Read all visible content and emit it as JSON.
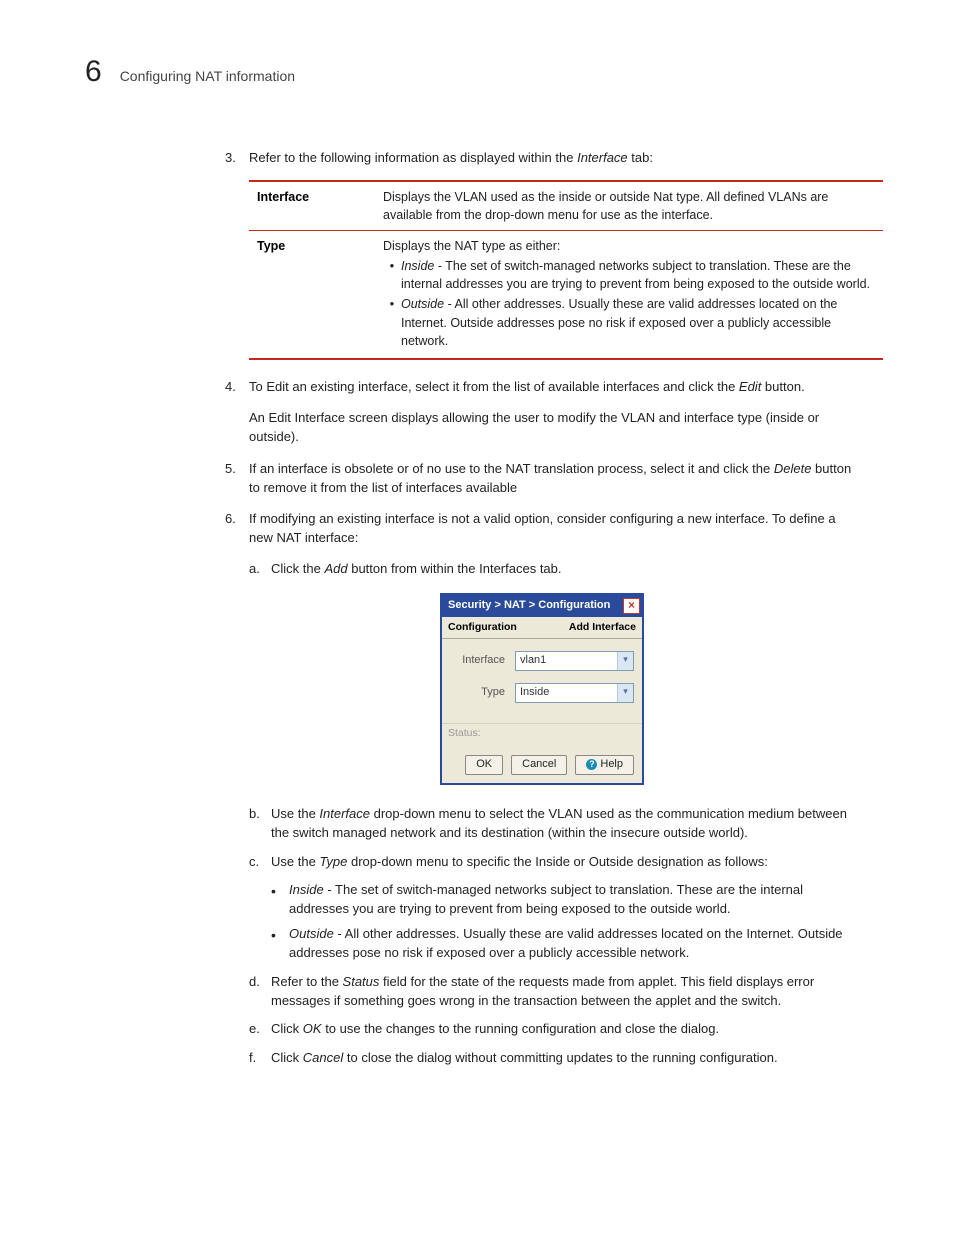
{
  "chapter_number": "6",
  "chapter_title": "Configuring NAT information",
  "step3": {
    "num": "3.",
    "pre": "Refer to the following information as displayed within the ",
    "em": "Interface",
    "post": " tab:"
  },
  "table": {
    "interface_label": "Interface",
    "interface_desc": "Displays the VLAN used as the inside or outside Nat type. All defined VLANs are available from the drop-down menu for use as the interface.",
    "type_label": "Type",
    "type_intro": "Displays the NAT type as either:",
    "type_inside_em": "Inside",
    "type_inside_txt": " - The set of switch-managed networks subject to translation. These are the internal addresses you are trying to prevent from being exposed to the outside world.",
    "type_outside_em": "Outside",
    "type_outside_txt": " - All other addresses. Usually these are valid addresses located on the Internet. Outside addresses pose no risk if exposed over a publicly accessible network."
  },
  "step4": {
    "num": "4.",
    "p1_a": "To Edit an existing interface, select it from the list of available interfaces and click the ",
    "p1_em": "Edit",
    "p1_b": " button.",
    "p2": "An Edit Interface screen displays allowing the user to modify the VLAN and interface type (inside or outside)."
  },
  "step5": {
    "num": "5.",
    "a": "If an interface is obsolete or of no use to the NAT translation process, select it and click the ",
    "em": "Delete",
    "b": " button to remove it from the list of interfaces available"
  },
  "step6": {
    "num": "6.",
    "txt": "If modifying an existing interface is not a valid option, consider configuring a new interface. To define a new NAT interface:"
  },
  "sub_a": {
    "num": "a.",
    "a": "Click the ",
    "em": "Add",
    "b": " button from within the Interfaces tab."
  },
  "dialog": {
    "title": "Security > NAT > Configuration",
    "hdr_left": "Configuration",
    "hdr_right": "Add Interface",
    "row1_label": "Interface",
    "row1_value": "vlan1",
    "row2_label": "Type",
    "row2_value": "Inside",
    "status_label": "Status:",
    "btn_ok": "OK",
    "btn_cancel": "Cancel",
    "btn_help": "Help"
  },
  "sub_b": {
    "num": "b.",
    "a": "Use the ",
    "em": "Interface",
    "b": " drop-down menu to select the VLAN used as the communication medium between the switch managed network and its destination (within the insecure outside world)."
  },
  "sub_c": {
    "num": "c.",
    "a": "Use the ",
    "em": "Type",
    "b": " drop-down menu to specific the Inside or Outside designation as follows:"
  },
  "bullet_inside": {
    "em": "Inside",
    "txt": " - The set of switch-managed networks subject to translation. These are the internal addresses you are trying to prevent from being exposed to the outside world."
  },
  "bullet_outside": {
    "em": "Outside",
    "txt": " - All other addresses. Usually these are valid addresses located on the Internet. Outside addresses pose no risk if exposed over a publicly accessible network."
  },
  "sub_d": {
    "num": "d.",
    "a": "Refer to the ",
    "em": "Status",
    "b": " field for the state of the requests made from applet. This field displays error messages if something goes wrong in the transaction between the applet and the switch."
  },
  "sub_e": {
    "num": "e.",
    "a": "Click ",
    "em": "OK",
    "b": " to use the changes to the running configuration and close the dialog."
  },
  "sub_f": {
    "num": "f.",
    "a": "Click ",
    "em": "Cancel",
    "b": " to close the dialog without committing updates to the running configuration."
  }
}
